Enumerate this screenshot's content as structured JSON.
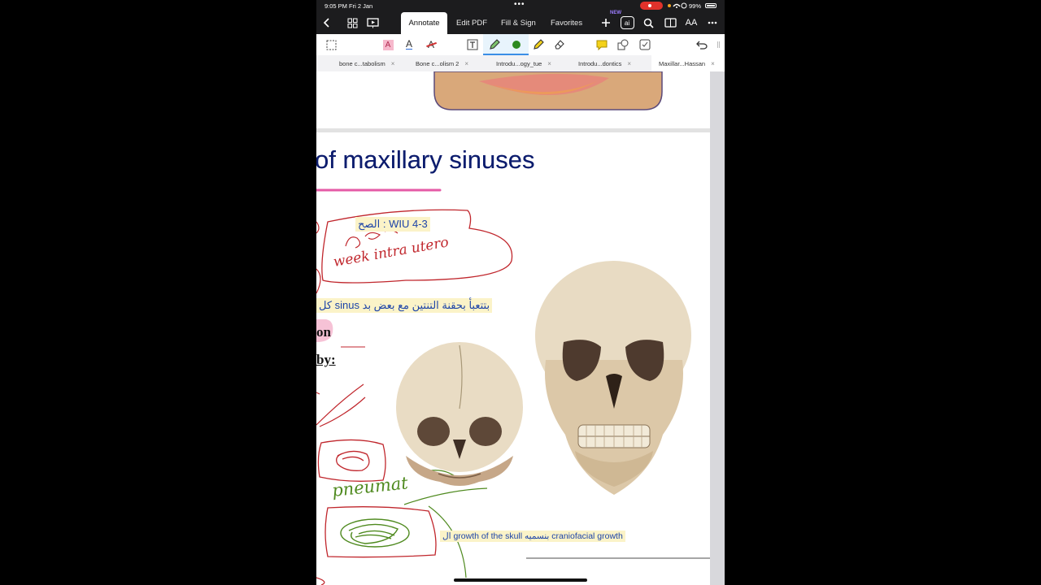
{
  "status_bar": {
    "time_date": "9:05 PM   Fri 2 Jan",
    "dots": "•••",
    "battery_text": "99%"
  },
  "toolbar": {
    "tabs": [
      "Annotate",
      "Edit PDF",
      "Fill & Sign",
      "Favorites"
    ],
    "new_badge": "NEW",
    "ai_label": "ai",
    "text_size_label": "AA"
  },
  "doc_tabs": [
    {
      "label": "bone c...tabolism",
      "active": false
    },
    {
      "label": "Bone c...olism 2",
      "active": false
    },
    {
      "label": "Introdu...ogy_tue",
      "active": false
    },
    {
      "label": "Introdu...dontics",
      "active": false
    },
    {
      "label": "Maxillar...Hassan",
      "active": true
    }
  ],
  "page": {
    "title": "of maxillary sinuses",
    "highlight_1": "الصح : WIU 4-3",
    "handwriting_1": "week intra utero",
    "highlight_2": "كل sinus بتتعبأ بحقنة التنتين مع بعض بد",
    "on_text": "on",
    "by_text": "by:",
    "handwriting_2": "pneumat",
    "highlight_3": "ال growth of the skull بنسميه craniofacial growth"
  },
  "colors": {
    "title": "#0d1d6e",
    "highlight_bg": "#fbf3c8",
    "highlight_text": "#1d44a8",
    "ink_red": "#c0262c",
    "ink_green": "#4f8a1f",
    "ink_pink": "#e55aa6"
  }
}
